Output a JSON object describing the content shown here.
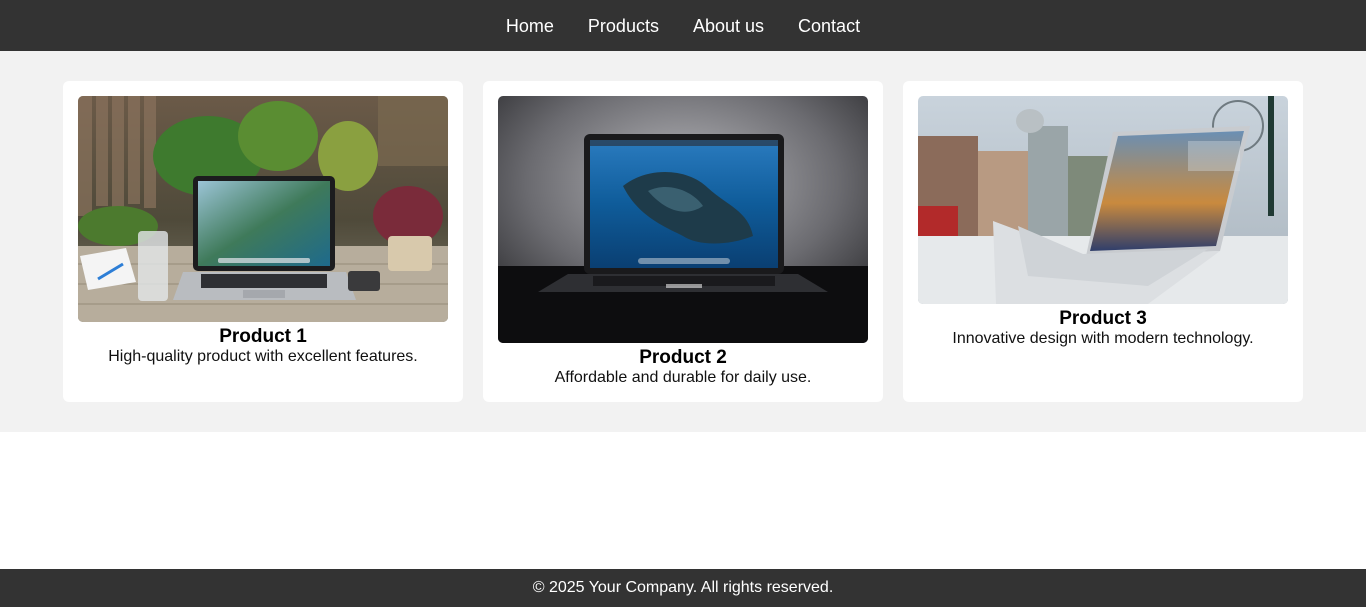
{
  "nav": {
    "items": [
      {
        "label": "Home"
      },
      {
        "label": "Products"
      },
      {
        "label": "About us"
      },
      {
        "label": "Contact"
      }
    ]
  },
  "products": [
    {
      "title": "Product 1",
      "description": "High-quality product with excellent features.",
      "image": "laptop-on-outdoor-table"
    },
    {
      "title": "Product 2",
      "description": "Affordable and durable for daily use.",
      "image": "laptop-dark-background"
    },
    {
      "title": "Product 3",
      "description": "Innovative design with modern technology.",
      "image": "laptop-city-view"
    }
  ],
  "footer": {
    "text": "© 2025 Your Company. All rights reserved."
  },
  "colors": {
    "nav_bg": "#333333",
    "section_bg": "#f2f2f2",
    "card_bg": "#ffffff",
    "footer_bg": "#333333"
  }
}
